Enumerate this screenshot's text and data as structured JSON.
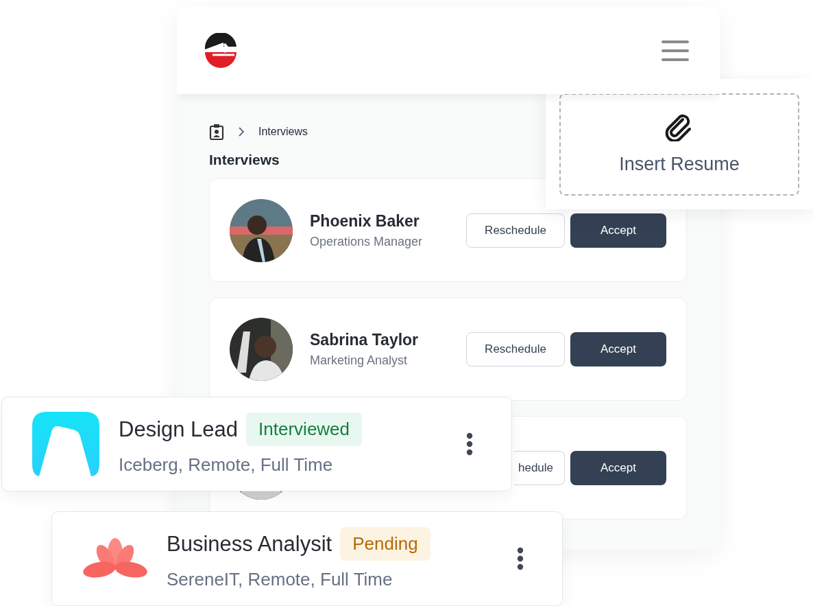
{
  "breadcrumb": {
    "current": "Interviews"
  },
  "page_title": "Interviews",
  "interviews": [
    {
      "name": "Phoenix Baker",
      "role": "Operations Manager",
      "reschedule": "Reschedule",
      "accept": "Accept"
    },
    {
      "name": "Sabrina Taylor",
      "role": "Marketing Analyst",
      "reschedule": "Reschedule",
      "accept": "Accept"
    },
    {
      "reschedule": "hedule",
      "accept": "Accept"
    }
  ],
  "resume_upload": {
    "label": "Insert Resume"
  },
  "jobs": [
    {
      "logo": {
        "kind": "arch"
      },
      "title": "Design Lead",
      "status": {
        "label": "Interviewed",
        "kind": "success"
      },
      "details": "Iceberg, Remote, Full Time"
    },
    {
      "logo": {
        "kind": "lotus"
      },
      "title": "Business Analysit",
      "status": {
        "label": "Pending",
        "kind": "warning"
      },
      "details": "SereneIT, Remote, Full Time"
    }
  ]
}
